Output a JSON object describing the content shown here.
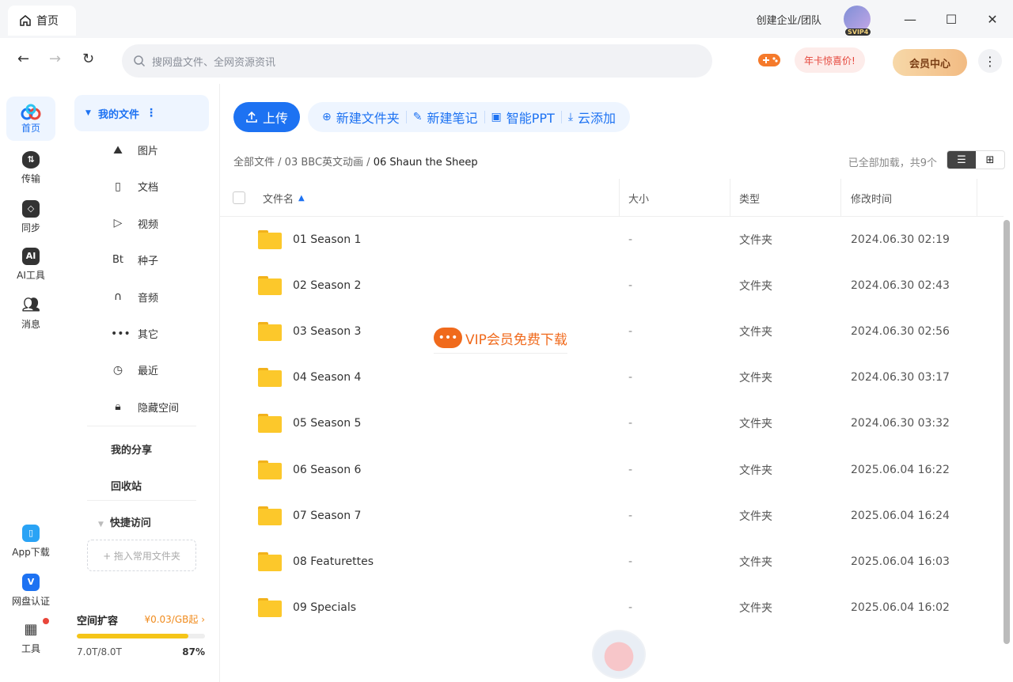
{
  "titlebar": {
    "tab_label": "首页",
    "create_team": "创建企业/团队",
    "vip_badge": "SVIP4",
    "minimize": "—",
    "maximize": "☐",
    "close": "✕"
  },
  "navbar": {
    "search_placeholder": "搜网盘文件、全网资源资讯",
    "promo": "年卡惊喜价!",
    "vip_center": "会员中心",
    "more": "⋮"
  },
  "rail": {
    "items": [
      {
        "label": "首页",
        "icon": "home-logo-icon",
        "active": true
      },
      {
        "label": "传输",
        "icon": "transfer-icon"
      },
      {
        "label": "同步",
        "icon": "sync-icon"
      },
      {
        "label": "AI工具",
        "icon": "ai-tool-icon"
      },
      {
        "label": "消息",
        "icon": "message-icon"
      }
    ],
    "bottom": [
      {
        "label": "App下载",
        "icon": "app-download-icon"
      },
      {
        "label": "网盘认证",
        "icon": "certification-icon"
      },
      {
        "label": "工具",
        "icon": "tools-icon"
      }
    ]
  },
  "sidebar": {
    "my_files": "我的文件",
    "categories": [
      {
        "label": "图片",
        "icon": "image-icon",
        "glyph": "⛰"
      },
      {
        "label": "文档",
        "icon": "document-icon",
        "glyph": "▯"
      },
      {
        "label": "视频",
        "icon": "video-icon",
        "glyph": "▷"
      },
      {
        "label": "种子",
        "icon": "torrent-icon",
        "glyph": "Bt"
      },
      {
        "label": "音频",
        "icon": "audio-icon",
        "glyph": "∩"
      },
      {
        "label": "其它",
        "icon": "other-icon",
        "glyph": "•••"
      },
      {
        "label": "最近",
        "icon": "recent-icon",
        "glyph": "◷"
      },
      {
        "label": "隐藏空间",
        "icon": "lock-icon",
        "glyph": "🔒︎"
      }
    ],
    "my_share": "我的分享",
    "recycle": "回收站",
    "quick_access": "快捷访问",
    "drop_hint": "+ 拖入常用文件夹",
    "space": {
      "title": "空间扩容",
      "price": "¥0.03/GB起 ›",
      "used": "7.0T/8.0T",
      "percent_label": "87%",
      "percent": 0.87
    }
  },
  "toolbar": {
    "upload": "上传",
    "tools": [
      {
        "label": "新建文件夹",
        "icon": "new-folder-icon",
        "glyph": "⊕"
      },
      {
        "label": "新建笔记",
        "icon": "new-note-icon",
        "glyph": "✎"
      },
      {
        "label": "智能PPT",
        "icon": "smart-ppt-icon",
        "glyph": "▣"
      },
      {
        "label": "云添加",
        "icon": "cloud-add-icon",
        "glyph": "⤓"
      }
    ]
  },
  "breadcrumb": {
    "root": "全部文件",
    "sep": " / ",
    "parent": "03 BBC英文动画",
    "current": "06 Shaun the Sheep"
  },
  "loaded_status": "已全部加载，共9个",
  "table": {
    "headers": {
      "name": "文件名",
      "size": "大小",
      "type": "类型",
      "modified": "修改时间"
    },
    "rows": [
      {
        "name": "01 Season 1",
        "size": "-",
        "type": "文件夹",
        "modified": "2024.06.30 02:19"
      },
      {
        "name": "02 Season 2",
        "size": "-",
        "type": "文件夹",
        "modified": "2024.06.30 02:43"
      },
      {
        "name": "03 Season 3",
        "size": "-",
        "type": "文件夹",
        "modified": "2024.06.30 02:56"
      },
      {
        "name": "04 Season 4",
        "size": "-",
        "type": "文件夹",
        "modified": "2024.06.30 03:17"
      },
      {
        "name": "05 Season 5",
        "size": "-",
        "type": "文件夹",
        "modified": "2024.06.30 03:32"
      },
      {
        "name": "06 Season 6",
        "size": "-",
        "type": "文件夹",
        "modified": "2025.06.04 16:22"
      },
      {
        "name": "07 Season 7",
        "size": "-",
        "type": "文件夹",
        "modified": "2025.06.04 16:24"
      },
      {
        "name": "08 Featurettes",
        "size": "-",
        "type": "文件夹",
        "modified": "2025.06.04 16:03"
      },
      {
        "name": "09 Specials",
        "size": "-",
        "type": "文件夹",
        "modified": "2025.06.04 16:02"
      }
    ]
  },
  "watermark": "VIP会员免费下载",
  "colors": {
    "accent": "#1d72f2",
    "folder": "#fcc82b",
    "progress": "#f5c518",
    "price": "#f08b1d"
  }
}
